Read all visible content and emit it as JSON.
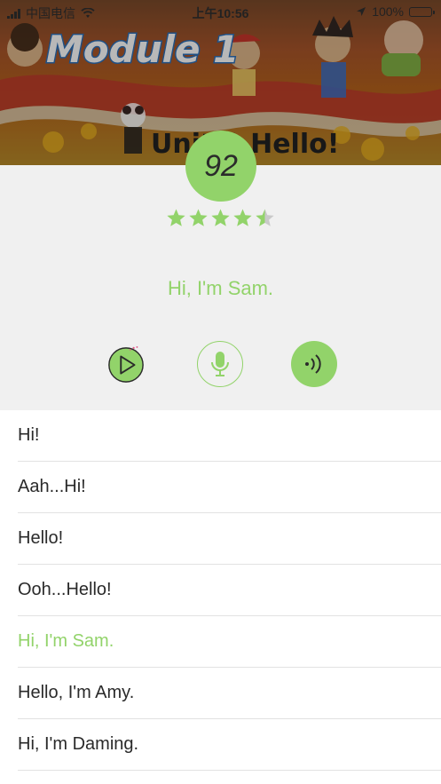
{
  "status_bar": {
    "carrier": "中国电信",
    "time": "上午10:56",
    "battery_text": "100%",
    "battery_level": 1.0
  },
  "banner": {
    "title": "Module 1",
    "subtitle": "Unit 1 Hello!"
  },
  "practice": {
    "score": "92",
    "rating": 4.5,
    "rating_max": 5,
    "current_sentence": "Hi, I'm Sam."
  },
  "controls": {
    "play_icon": "play-icon",
    "record_icon": "microphone-icon",
    "listen_icon": "sound-wave-icon"
  },
  "sentences": [
    {
      "text": "Hi!",
      "active": false
    },
    {
      "text": "Aah...Hi!",
      "active": false
    },
    {
      "text": "Hello!",
      "active": false
    },
    {
      "text": "Ooh...Hello!",
      "active": false
    },
    {
      "text": "Hi, I'm Sam.",
      "active": true
    },
    {
      "text": "Hello, I'm Amy.",
      "active": false
    },
    {
      "text": "Hi, I'm Daming.",
      "active": false
    }
  ],
  "colors": {
    "accent": "#92d36a",
    "panel_bg": "#f0f0f0",
    "text": "#2a2a2a",
    "divider": "#e2e2e2"
  }
}
